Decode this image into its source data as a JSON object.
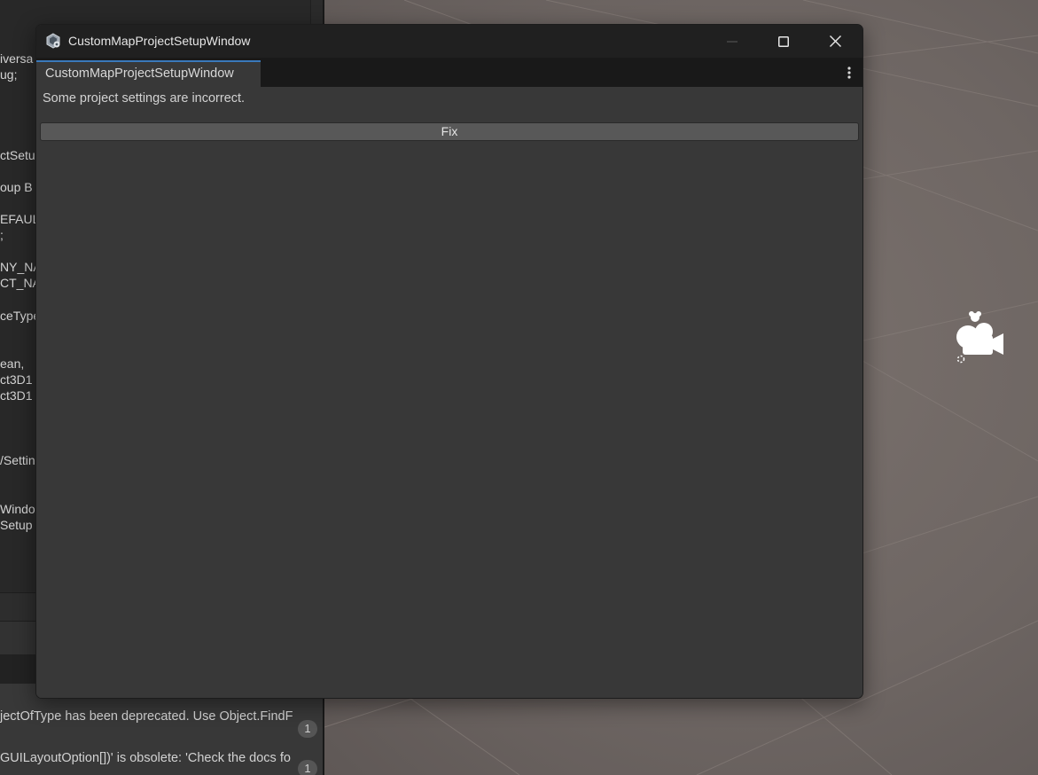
{
  "window": {
    "title": "CustomMapProjectSetupWindow",
    "tab_label": "CustomMapProjectSetupWindow",
    "status_message": "Some project settings are incorrect.",
    "fix_label": "Fix",
    "icons": {
      "app": "unity-editor-icon",
      "minimize": "minimize-icon",
      "maximize": "maximize-icon",
      "close": "close-icon",
      "tab_menu": "vertical-ellipsis-icon"
    }
  },
  "background_code": {
    "lines": [
      "iversa",
      "ug;",
      "ctSetu",
      "oup B",
      "EFAUL",
      ";",
      "NY_NA",
      "CT_NA",
      "ceType",
      "ean,",
      "ct3D1",
      "ct3D1",
      "/Settin",
      "Windo",
      "Setup"
    ]
  },
  "console": {
    "lines": [
      "jectOfType has been deprecated. Use Object.FindF",
      "GUILayoutOption[])' is obsolete: 'Check the docs fo"
    ],
    "counts": [
      "1",
      "1"
    ]
  },
  "colors": {
    "accent": "#3a79bb",
    "window_bg": "#383838",
    "titlebar_bg": "#202020",
    "button_bg": "#585858"
  }
}
